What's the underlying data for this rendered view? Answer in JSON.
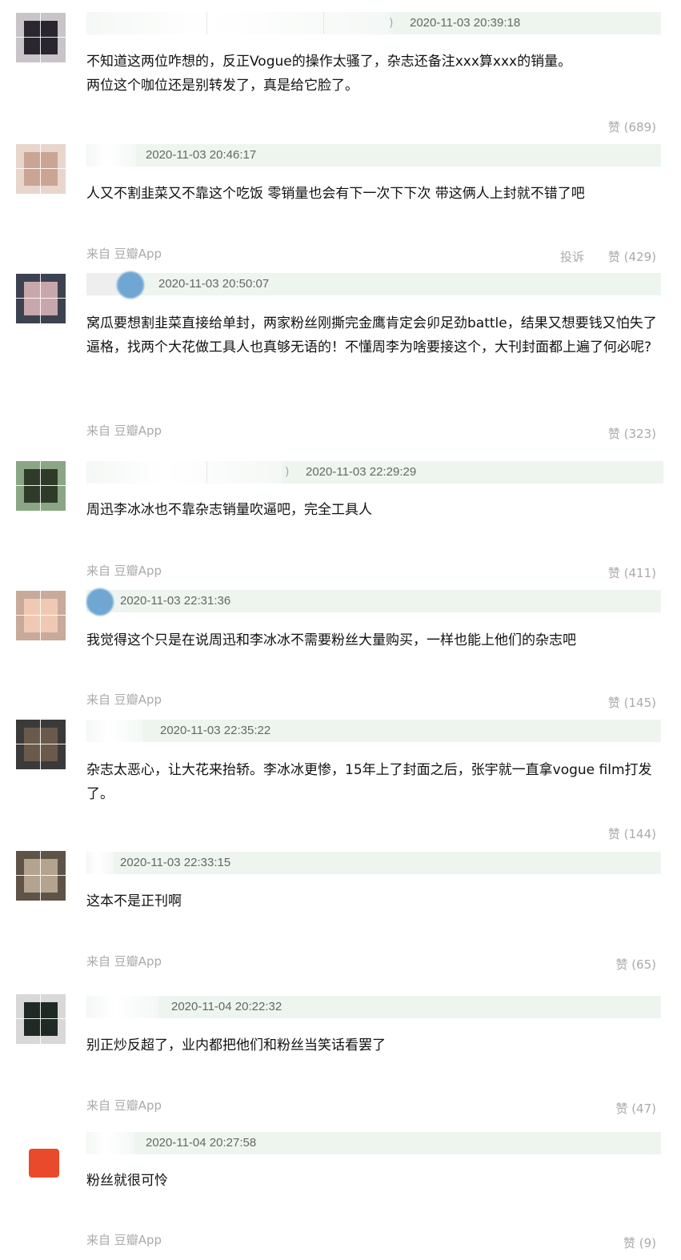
{
  "comments": [
    {
      "time": "2020-11-03 20:39:18",
      "content": "不知道这两位咋想的，反正Vogue的操作太骚了，杂志还备注xxx算xxx的销量。\n两位这个咖位还是别转发了，真是给它脸了。",
      "source": "",
      "report": "",
      "likes": "赞 (689)",
      "avatar_color": "#2a2630",
      "avatar_bg": "#c9c4c8"
    },
    {
      "time": "2020-11-03 20:46:17",
      "content": "人又不割韭菜又不靠这个吃饭 零销量也会有下一次下下次 带这俩人上封就不错了吧",
      "source": "来自 豆瓣App",
      "report": "投诉",
      "likes": "赞 (429)",
      "avatar_color": "#caa594",
      "avatar_bg": "#e8d6cc"
    },
    {
      "time": "2020-11-03 20:50:07",
      "content": "窝瓜要想割韭菜直接给单封，两家粉丝刚撕完金鹰肯定会卯足劲battle，结果又想要钱又怕失了逼格，找两个大花做工具人也真够无语的！不懂周李为啥要接这个，大刊封面都上遍了何必呢?",
      "source": "来自 豆瓣App",
      "report": "",
      "likes": "赞 (323)",
      "avatar_color": "#c8a7ac",
      "avatar_bg": "#3c4250"
    },
    {
      "time": "2020-11-03 22:29:29",
      "content": "周迅李冰冰也不靠杂志销量吹逼吧，完全工具人",
      "source": "来自 豆瓣App",
      "report": "",
      "likes": "赞 (411)",
      "avatar_color": "#2f3b28",
      "avatar_bg": "#8aa685"
    },
    {
      "time": "2020-11-03 22:31:36",
      "content": "我觉得这个只是在说周迅和李冰冰不需要粉丝大量购买，一样也能上他们的杂志吧",
      "source": "来自 豆瓣App",
      "report": "",
      "likes": "赞 (145)",
      "avatar_color": "#f0c9b4",
      "avatar_bg": "#c9a99a"
    },
    {
      "time": "2020-11-03 22:35:22",
      "content": "杂志太恶心，让大花来抬轿。李冰冰更惨，15年上了封面之后，张宇就一直拿vogue film打发了。",
      "source": "",
      "report": "",
      "likes": "赞 (144)",
      "avatar_color": "#6b5a4c",
      "avatar_bg": "#3a3a3a"
    },
    {
      "time": "2020-11-03 22:33:15",
      "content": "这本不是正刊啊",
      "source": "来自 豆瓣App",
      "report": "",
      "likes": "赞 (65)",
      "avatar_color": "#b3a38f",
      "avatar_bg": "#5d5346"
    },
    {
      "time": "2020-11-04 20:22:32",
      "content": "别正炒反超了，业内都把他们和粉丝当笑话看罢了",
      "source": "来自 豆瓣App",
      "report": "",
      "likes": "赞 (47)",
      "avatar_color": "#1f2a24",
      "avatar_bg": "#d8d8d8"
    },
    {
      "time": "2020-11-04 20:27:58",
      "content": "粉丝就很可怜",
      "source": "来自 豆瓣App",
      "report": "",
      "likes": "赞 (9)",
      "avatar_color": "#e84a2b",
      "avatar_bg": "#ffffff"
    }
  ]
}
